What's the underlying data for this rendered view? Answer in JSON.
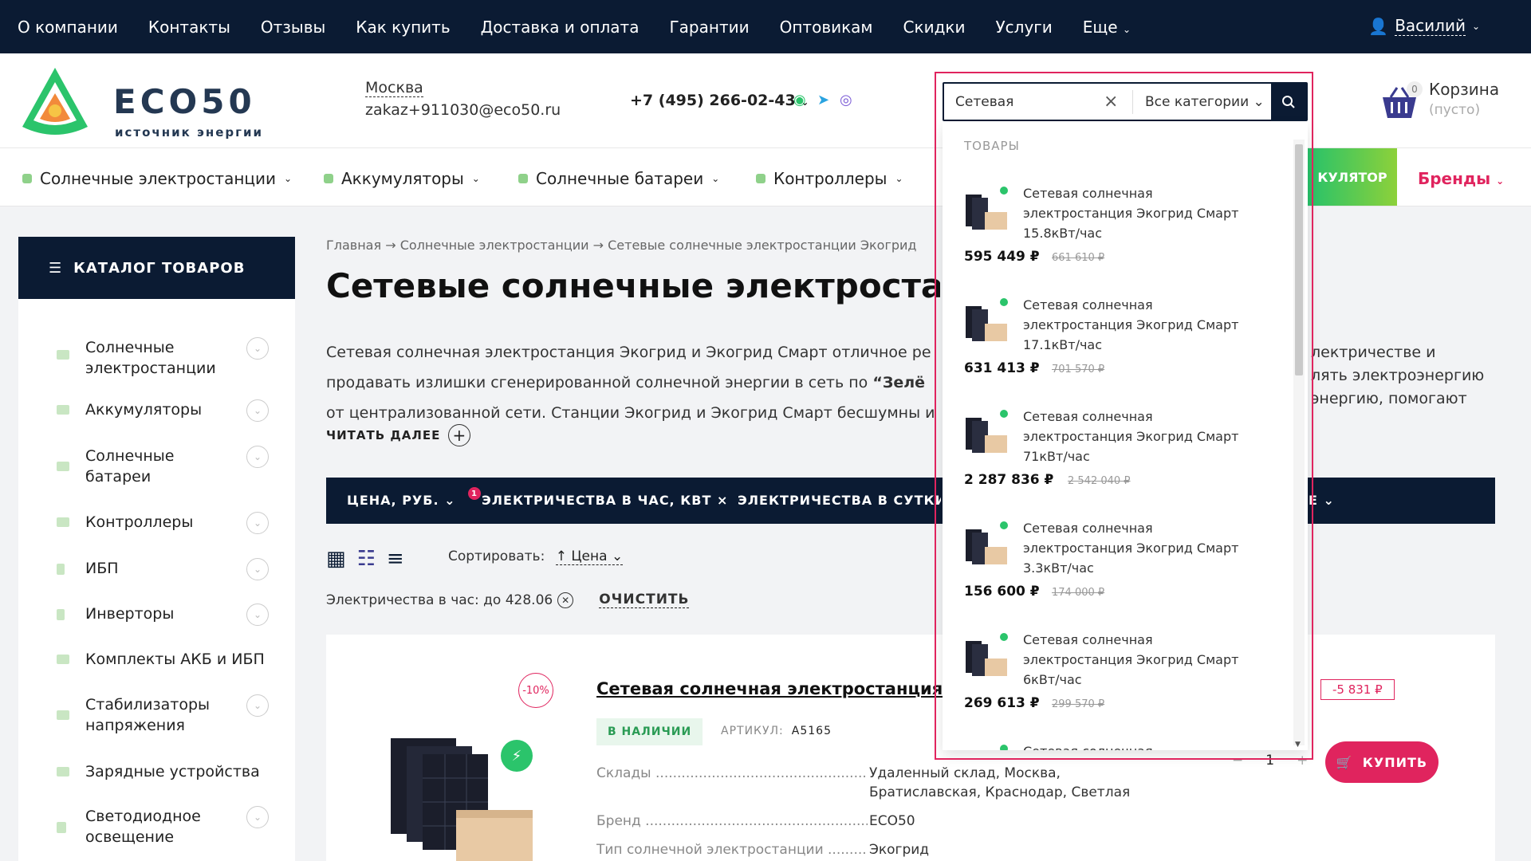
{
  "topnav": {
    "items": [
      "О компании",
      "Контакты",
      "Отзывы",
      "Как купить",
      "Доставка и оплата",
      "Гарантии",
      "Оптовикам",
      "Скидки",
      "Услуги",
      "Еще"
    ],
    "user": "Василий"
  },
  "header": {
    "brand": "ECO50",
    "tagline": "источник энергии",
    "city": "Москва",
    "email": "zakaz+911030@eco50.ru",
    "phone": "+7 (495) 266-02-43",
    "cart_label": "Корзина",
    "cart_status": "(пусто)",
    "cart_count": "0"
  },
  "menu": {
    "items": [
      "Солнечные электростанции",
      "Аккумуляторы",
      "Солнечные батареи",
      "Контроллеры"
    ],
    "promo": "КУЛЯТОР",
    "brands": "Бренды"
  },
  "sidebar": {
    "title": "КАТАЛОГ ТОВАРОВ",
    "items": [
      {
        "label": "Солнечные электростанции"
      },
      {
        "label": "Аккумуляторы"
      },
      {
        "label": "Солнечные батареи"
      },
      {
        "label": "Контроллеры"
      },
      {
        "label": "ИБП"
      },
      {
        "label": "Инверторы"
      },
      {
        "label": "Комплекты АКБ и ИБП"
      },
      {
        "label": "Стабилизаторы напряжения"
      },
      {
        "label": "Зарядные устройства"
      },
      {
        "label": "Светодиодное освещение"
      }
    ]
  },
  "page": {
    "breadcrumbs": [
      "Главная",
      "Солнечные электростанции",
      "Сетевые солнечные электростанции Экогрид"
    ],
    "title": "Сетевые солнечные электростанции Экогрид",
    "desc_1": "Сетевая солнечная электростанция Экогрид и Экогрид Смарт отличное ре",
    "desc_1b": "лектричестве и",
    "desc_2": "продавать излишки сгенерированной солнечной энергии в сеть по ",
    "desc_2q": "“Зелё",
    "desc_2b": "лять электроэнергию",
    "desc_3": "от централизованной сети. Станции Экогрид и Экогрид Смарт бесшумны и",
    "desc_3b": "энергию, помогают",
    "read_more": "ЧИТАТЬ ДАЛЕЕ",
    "filters": [
      "ЦЕНА, РУБ.",
      "ЭЛЕКТРИЧЕСТВА В ЧАС, КВТ ×",
      "ЭЛЕКТРИЧЕСТВА В СУТКИ, КЕ",
      "Е"
    ],
    "filter_badge": "1",
    "sort_label": "Сортировать:",
    "sort_value": "Цена",
    "active_filter": "Электричества в час: до 428.06",
    "clear": "ОЧИСТИТЬ"
  },
  "product": {
    "discount": "-10%",
    "title": "Сетевая солнечная электростанция Экогрид Смарт",
    "stock": "В НАЛИЧИИ",
    "sku_label": "АРТИКУЛ:",
    "sku": "A5165",
    "props": [
      {
        "name": "Склады",
        "value": "Удаленный склад, Москва, Братиславская, Краснодар, Светлая"
      },
      {
        "name": "Бренд",
        "value": "ECO50"
      },
      {
        "name": "Тип солнечной электростанции",
        "value": "Экогрид"
      }
    ],
    "saving": "-5 831 ₽",
    "qty": "1",
    "buy": "КУПИТЬ"
  },
  "search": {
    "value": "Сетевая",
    "category": "Все категории",
    "section_header": "ТОВАРЫ",
    "results": [
      {
        "name": "Сетевая солнечная электростанция Экогрид Смарт 15.8кВт/час",
        "price": "595 449 ₽",
        "old": "661 610 ₽"
      },
      {
        "name": "Сетевая солнечная электростанция Экогрид Смарт 17.1кВт/час",
        "price": "631 413 ₽",
        "old": "701 570 ₽"
      },
      {
        "name": "Сетевая солнечная электростанция Экогрид Смарт 71кВт/час",
        "price": "2 287 836 ₽",
        "old": "2 542 040 ₽"
      },
      {
        "name": "Сетевая солнечная электростанция Экогрид Смарт 3.3кВт/час",
        "price": "156 600 ₽",
        "old": "174 000 ₽"
      },
      {
        "name": "Сетевая солнечная электростанция Экогрид Смарт 6кВт/час",
        "price": "269 613 ₽",
        "old": "299 570 ₽"
      },
      {
        "name": "Сетевая солнечная",
        "price": "",
        "old": ""
      }
    ]
  },
  "colors": {
    "navy": "#0b1b33",
    "accent": "#e0245e",
    "green": "#2bc46b"
  }
}
